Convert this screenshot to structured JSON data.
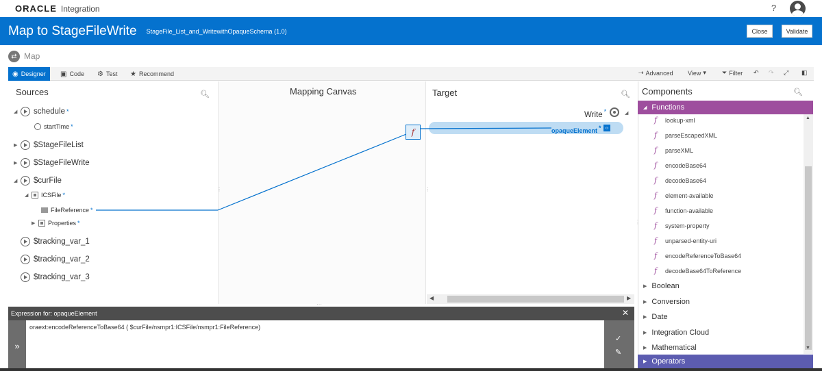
{
  "topbar": {
    "brand": "ORACLE",
    "product": "Integration",
    "help": "?"
  },
  "titlebar": {
    "title": "Map to StageFileWrite",
    "subtitle": "StageFile_List_and_WritewithOpaqueSchema (1.0)",
    "close_label": "Close",
    "validate_label": "Validate"
  },
  "mapbar": {
    "label": "Map"
  },
  "toolbar": {
    "tabs": [
      "Designer",
      "Code",
      "Test",
      "Recommend"
    ],
    "advanced": "Advanced",
    "view": "View",
    "filter": "Filter"
  },
  "sources": {
    "title": "Sources",
    "nodes": [
      "schedule",
      "startTime",
      "$StageFileList",
      "$StageFileWrite",
      "$curFile",
      "ICSFile",
      "FileReference",
      "Properties",
      "$tracking_var_1",
      "$tracking_var_2",
      "$tracking_var_3"
    ]
  },
  "canvas": {
    "title": "Mapping Canvas"
  },
  "target": {
    "title": "Target",
    "root": "Write",
    "element": "opaqueElement"
  },
  "components": {
    "title": "Components",
    "functions_label": "Functions",
    "functions": [
      "lookup-xml",
      "parseEscapedXML",
      "parseXML",
      "encodeBase64",
      "decodeBase64",
      "element-available",
      "function-available",
      "system-property",
      "unparsed-entity-uri",
      "encodeReferenceToBase64",
      "decodeBase64ToReference"
    ],
    "categories": [
      "Boolean",
      "Conversion",
      "Date",
      "Integration Cloud",
      "Mathematical"
    ],
    "operators_label": "Operators"
  },
  "expression": {
    "header_prefix": "Expression for:",
    "header_target": "opaqueElement",
    "text": "oraext:encodeReferenceToBase64 (  $curFile/nsmpr1:ICSFile/nsmpr1:FileReference)"
  },
  "colors": {
    "brand_blue": "#0572ce",
    "functions_purple": "#9e4e9e",
    "operators_blue": "#5c5cb0"
  }
}
